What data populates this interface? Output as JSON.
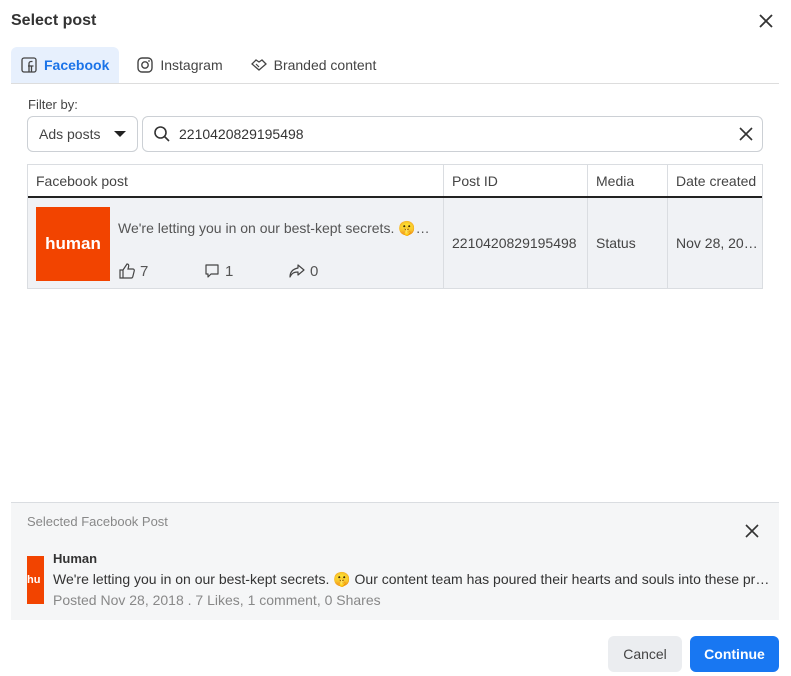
{
  "dialog": {
    "title": "Select post"
  },
  "tabs": [
    {
      "label": "Facebook",
      "icon": "facebook-icon",
      "active": true
    },
    {
      "label": "Instagram",
      "icon": "instagram-icon"
    },
    {
      "label": "Branded content",
      "icon": "handshake-icon"
    }
  ],
  "filter": {
    "label": "Filter by:",
    "selected": "Ads posts",
    "search_value": "2210420829195498"
  },
  "table": {
    "columns": [
      "Facebook post",
      "Post ID",
      "Media",
      "Date created"
    ],
    "rows": [
      {
        "thumb_text": "human",
        "text": "We're letting you in on our best-kept secrets. 🤫…",
        "likes": "7",
        "comments": "1",
        "shares": "0",
        "post_id": "2210420829195498",
        "media": "Status",
        "date": "Nov 28, 20…"
      }
    ]
  },
  "selected": {
    "label": "Selected Facebook Post",
    "thumb_text": "hu",
    "name": "Human",
    "text": "We're letting you in on our best-kept secrets. 🤫 Our content team has poured their hearts and souls into these pro…",
    "meta": "Posted Nov 28, 2018 . 7 Likes, 1 comment, 0 Shares"
  },
  "buttons": {
    "cancel": "Cancel",
    "continue": "Continue"
  },
  "colors": {
    "accent": "#1877f2",
    "thumb": "#f24400"
  }
}
